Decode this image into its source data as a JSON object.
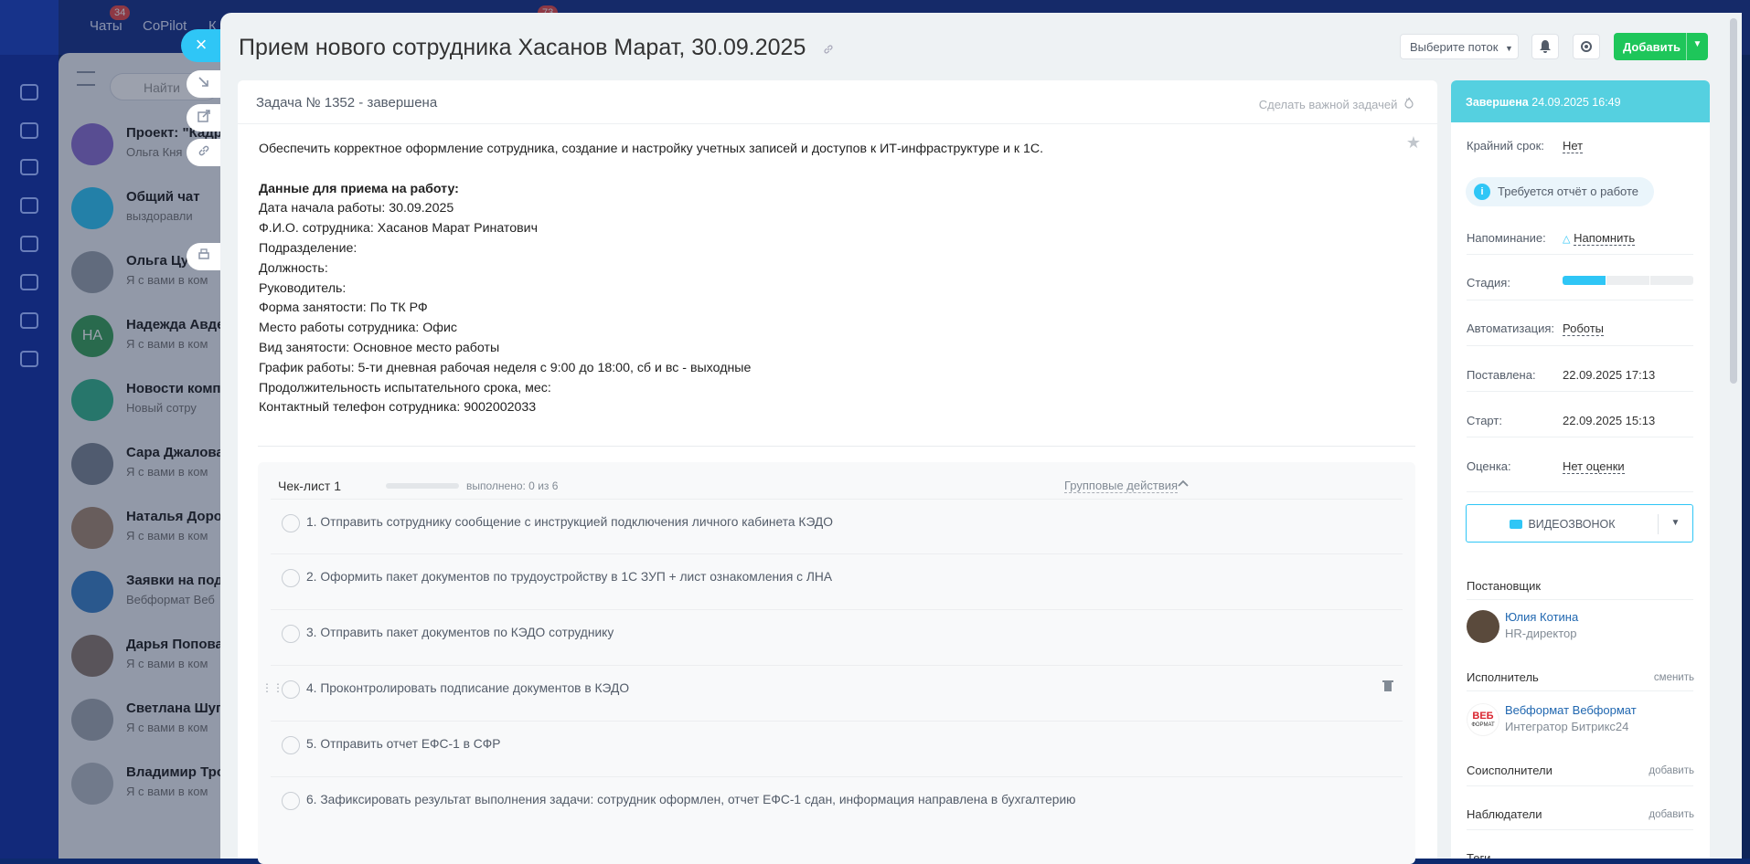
{
  "background": {
    "tabs": [
      {
        "label": "Чаты",
        "count": "34"
      },
      {
        "label": "CoPilot",
        "count": ""
      },
      {
        "label": "К",
        "count": ""
      }
    ],
    "top_counter": "73",
    "search_placeholder": "Найти",
    "chats": [
      {
        "name": "Проект: \"Кадр",
        "sub": "Ольга Кня"
      },
      {
        "name": "Общий чат",
        "sub": "выздоравли"
      },
      {
        "name": "Ольга Цу",
        "sub": "Я с вами в ком"
      },
      {
        "name": "Надежда Авде",
        "sub": "Я с вами в ком",
        "initials": "НА"
      },
      {
        "name": "Новости комп",
        "sub": "Новый сотру"
      },
      {
        "name": "Сара Джалова",
        "sub": "Я с вами в ком"
      },
      {
        "name": "Наталья Доро",
        "sub": "Я с вами в ком"
      },
      {
        "name": "Заявки на под",
        "sub": "Вебформат Веб"
      },
      {
        "name": "Дарья Попова",
        "sub": "Я с вами в ком"
      },
      {
        "name": "Светлана Шуп",
        "sub": "Я с вами в ком"
      },
      {
        "name": "Владимир Тро",
        "sub": "Я с вами в ком"
      }
    ]
  },
  "header": {
    "title": "Прием нового сотрудника Хасанов Марат, 30.09.2025",
    "flow_select": "Выберите поток",
    "add_label": "Добавить"
  },
  "task": {
    "number_status": "Задача № 1352 - завершена",
    "make_important": "Сделать важной задачей",
    "description": {
      "intro": "Обеспечить корректное оформление сотрудника, создание и настройку учетных записей и доступов к ИТ-инфраструктуре и к 1С.",
      "heading": "Данные для приема на работу:",
      "lines": [
        "Дата начала работы: 30.09.2025",
        "Ф.И.О. сотрудника: Хасанов Марат Ринатович",
        "Подразделение:",
        "Должность:",
        "Руководитель:",
        "Форма занятости: По ТК РФ",
        "Место работы сотрудника: Офис",
        "Вид занятости: Основное место работы",
        "График работы: 5-ти дневная рабочая неделя с 9:00 до 18:00, сб и вс - выходные",
        "Продолжительность испытательного срока, мес:",
        "Контактный телефон сотрудника: 9002002033"
      ]
    },
    "checklist": {
      "title": "Чек-лист 1",
      "progress_label": "выполнено: 0 из 6",
      "progress_fraction": 0,
      "group_actions": "Групповые действия",
      "items": [
        "1. Отправить сотруднику сообщение с инструкцией подключения личного кабинета КЭДО",
        "2. Оформить пакет документов по трудоустройству в 1С ЗУП + лист ознакомления с ЛНА",
        "3. Отправить пакет документов по КЭДО сотруднику",
        "4. Проконтролировать подписание документов в КЭДО",
        "5. Отправить отчет ЕФС-1 в СФР",
        "6. Зафиксировать результат выполнения задачи: сотрудник оформлен, отчет ЕФС-1 сдан, информация направлена в бухгалтерию"
      ]
    }
  },
  "sidebar": {
    "status_label": "Завершена",
    "status_date": "24.09.2025 16:49",
    "deadline_label": "Крайний срок:",
    "deadline_value": "Нет",
    "report_required": "Требуется отчёт о работе",
    "reminder_label": "Напоминание:",
    "reminder_value": "Напомнить",
    "stage_label": "Стадия:",
    "stage_fraction": 0.33,
    "automation_label": "Автоматизация:",
    "automation_value": "Роботы",
    "created_label": "Поставлена:",
    "created_value": "22.09.2025 17:13",
    "start_label": "Старт:",
    "start_value": "22.09.2025 15:13",
    "rating_label": "Оценка:",
    "rating_value": "Нет оценки",
    "video_call": "ВИДЕОЗВОНОК",
    "creator_header": "Постановщик",
    "creator": {
      "name": "Юлия Котина",
      "role": "HR-директор"
    },
    "assignee_header": "Исполнитель",
    "assignee_action": "сменить",
    "assignee": {
      "name": "Вебформат Вебформат",
      "role": "Интегратор Битрикс24",
      "logo_top": "ВЕБ",
      "logo_bottom": "ФОРМАТ"
    },
    "coexec_header": "Соисполнители",
    "coexec_action": "добавить",
    "observers_header": "Наблюдатели",
    "observers_action": "добавить",
    "tags_header": "Теги"
  },
  "colors": {
    "accent": "#2fc6f6",
    "success": "#1ec65a",
    "status_bar": "#55d0e0",
    "badge": "#e54a4a"
  }
}
